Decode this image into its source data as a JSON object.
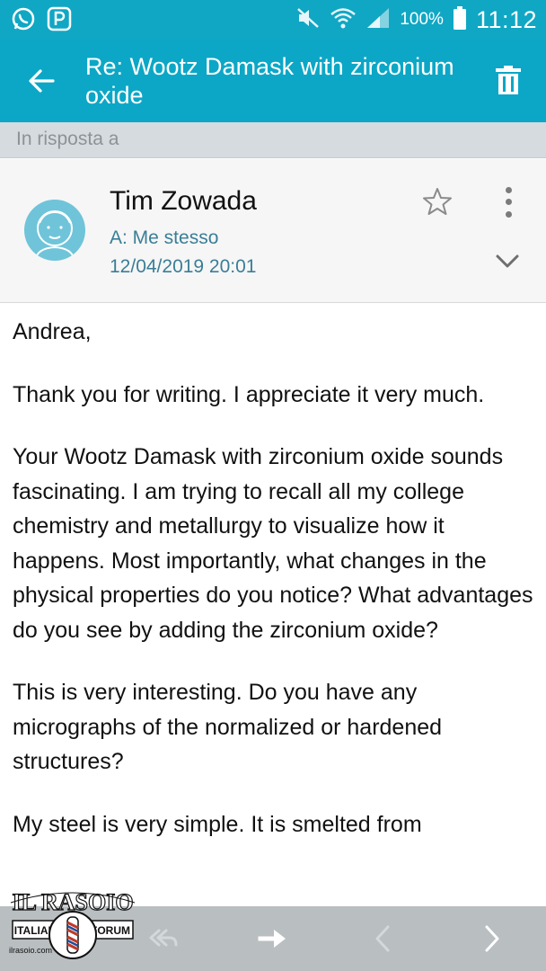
{
  "status_bar": {
    "battery_percent": "100%",
    "time": "11:12",
    "icons": [
      "whatsapp-icon",
      "pushbullet-icon",
      "mute-icon",
      "wifi-icon",
      "signal-icon",
      "battery-icon"
    ]
  },
  "app_bar": {
    "title": "Re:  Wootz Damask with zirconium oxide",
    "back_icon": "arrow-back-icon",
    "delete_icon": "trash-icon"
  },
  "reply_strip": {
    "label": "In risposta a"
  },
  "header": {
    "sender": "Tim Zowada",
    "to": "A: Me stesso",
    "date": "12/04/2019  20:01",
    "avatar_icon": "avatar-icon",
    "star_icon": "star-outline-icon",
    "more_icon": "more-vert-icon",
    "expand_icon": "chevron-down-icon"
  },
  "message": {
    "paragraphs": [
      "Andrea,",
      "Thank you for writing. I appreciate it very much.",
      "Your Wootz Damask with zirconium oxide sounds fascinating. I am trying to recall all my college chemistry and metallurgy to visualize how it happens. Most importantly, what changes in the physical properties do you notice? What advantages do you see by adding the zirconium oxide?",
      "This is very interesting. Do you have any micrographs of the normalized or hardened structures?",
      "My steel is very simple. It is smelted from"
    ]
  },
  "bottom_bar": {
    "icons": [
      "reply-all-icon",
      "forward-icon",
      "previous-icon",
      "next-icon"
    ]
  },
  "watermark": {
    "line1": "IL RASOIO",
    "left": "ITALIAN",
    "right": "FORUM",
    "site": "ilrasoio.com"
  },
  "colors": {
    "app_bar": "#0ca7c6",
    "status_bar": "#10a7c4",
    "reply_strip": "#d5dbde",
    "accent_text": "#3a7e96",
    "bottom_bar": "#b9bec1"
  }
}
